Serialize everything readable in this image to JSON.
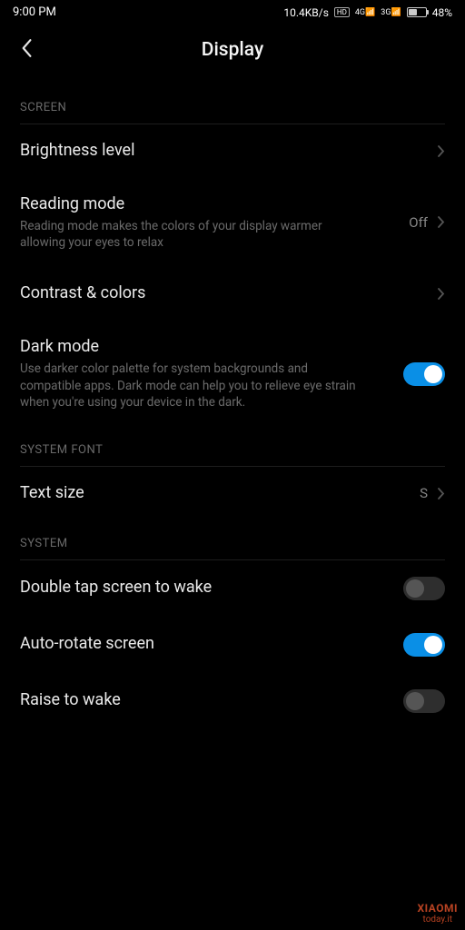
{
  "status": {
    "time": "9:00 PM",
    "speed": "10.4KB/s",
    "net_badge": "HD",
    "sig1": "4G",
    "sig2": "3G",
    "battery_pct": "48%"
  },
  "header": {
    "title": "Display"
  },
  "sections": {
    "screen_label": "SCREEN",
    "system_font_label": "SYSTEM FONT",
    "system_label": "SYSTEM"
  },
  "rows": {
    "brightness": {
      "title": "Brightness level"
    },
    "reading_mode": {
      "title": "Reading mode",
      "sub": "Reading mode makes the colors of your display warmer allowing your eyes to relax",
      "value": "Off"
    },
    "contrast": {
      "title": "Contrast & colors"
    },
    "dark_mode": {
      "title": "Dark mode",
      "sub": "Use darker color palette for system backgrounds and compatible apps. Dark mode can help you to relieve eye strain when you're using your device in the dark.",
      "on": true
    },
    "text_size": {
      "title": "Text size",
      "value": "S"
    },
    "double_tap": {
      "title": "Double tap screen to wake",
      "on": false
    },
    "auto_rotate": {
      "title": "Auto-rotate screen",
      "on": true
    },
    "raise_wake": {
      "title": "Raise to wake",
      "on": false
    }
  },
  "watermark": {
    "brand": "XIAOMI",
    "site": "today.it"
  }
}
